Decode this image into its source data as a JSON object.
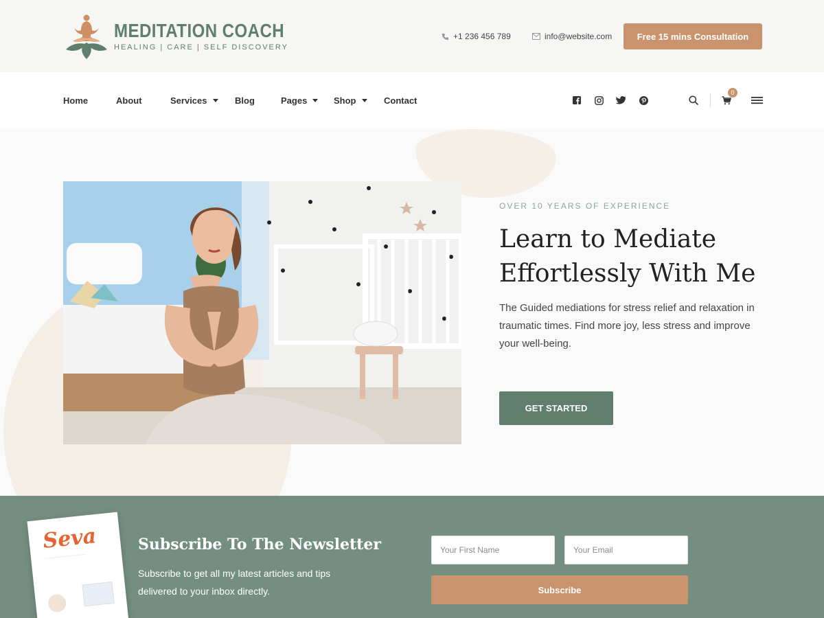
{
  "brand": {
    "name": "MEDITATION COACH",
    "tagline": "HEALING | CARE | SELF DISCOVERY"
  },
  "contact": {
    "phone": "+1 236 456 789",
    "email": "info@website.com",
    "consult_label": "Free 15 mins Consultation"
  },
  "nav": {
    "items": [
      {
        "label": "Home"
      },
      {
        "label": "About"
      },
      {
        "label": "Services"
      },
      {
        "label": "Blog"
      },
      {
        "label": "Pages"
      },
      {
        "label": "Shop"
      },
      {
        "label": "Contact"
      }
    ],
    "social": [
      "facebook-icon",
      "instagram-icon",
      "twitter-icon",
      "pinterest-icon"
    ],
    "cart_count": "0"
  },
  "hero": {
    "eyebrow": "OVER 10 YEARS OF EXPERIENCE",
    "headline": "Learn to Mediate Effortlessly With Me",
    "description": "The Guided mediations for stress relief and relaxation in traumatic times. Find more joy, less stress and improve your well-being.",
    "cta_label": "GET STARTED"
  },
  "newsletter": {
    "book_title": "Seva",
    "title": "Subscribe To The Newsletter",
    "description": "Subscribe to get all my latest articles and tips delivered to your inbox directly.",
    "first_name_placeholder": "Your First Name",
    "email_placeholder": "Your Email",
    "subscribe_label": "Subscribe"
  },
  "colors": {
    "sage": "#5f7e6d",
    "newsletter_bg": "#748f81",
    "accent": "#c9946d"
  }
}
